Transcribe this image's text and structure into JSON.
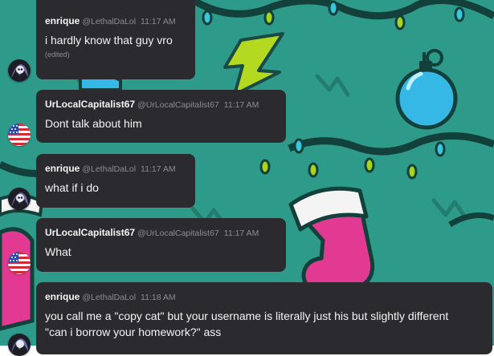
{
  "colors": {
    "background": "#2d9a8a",
    "bubble": "#2b2b2f",
    "lights_wire": "#13403a",
    "bulb_cyan": "#39c7e0",
    "bulb_green": "#a6d41f",
    "stocking_pink": "#e23a92",
    "ornament_blue": "#36b8e6"
  },
  "icons": {
    "enrique_avatar": "dark-character-avatar-icon",
    "capitalist_avatar": "us-flag-avatar-icon"
  },
  "messages": [
    {
      "author": "enrique",
      "handle": "@LethalDaLol",
      "time": "11:17 AM",
      "text": "i hardly know that guy vro",
      "edited": "(edited)"
    },
    {
      "author": "UrLocalCapitalist67",
      "handle": "@UrLocalCapitalist67",
      "time": "11:17 AM",
      "text": "Dont talk about him"
    },
    {
      "author": "enrique",
      "handle": "@LethalDaLol",
      "time": "11:17 AM",
      "text": "what if i do"
    },
    {
      "author": "UrLocalCapitalist67",
      "handle": "@UrLocalCapitalist67",
      "time": "11:17 AM",
      "text": "What"
    },
    {
      "author": "enrique",
      "handle": "@LethalDaLol",
      "time": "11:18 AM",
      "text": "you call me a \"copy cat\" but your username is literally just his but slightly different \"can i borrow your homework?\" ass"
    }
  ]
}
